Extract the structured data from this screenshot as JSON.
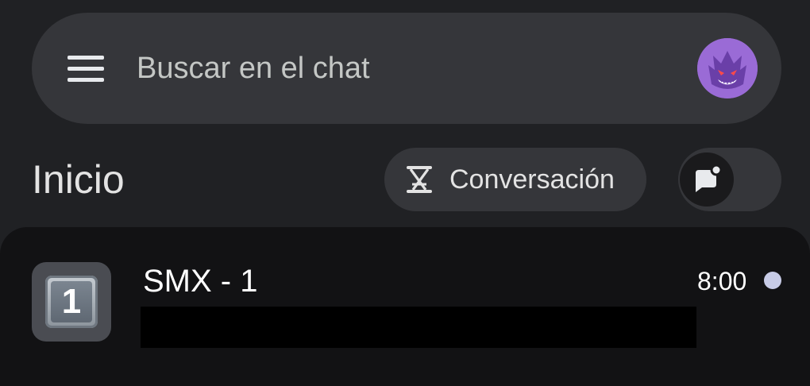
{
  "search": {
    "placeholder": "Buscar en el chat"
  },
  "header": {
    "title": "Inicio",
    "conversation_chip_label": "Conversación"
  },
  "chats": [
    {
      "name": "SMX - 1",
      "avatar_glyph": "1",
      "time": "8:00",
      "unread": true
    }
  ],
  "icons": {
    "menu": "hamburger-menu-icon",
    "avatar": "profile-avatar",
    "conversation": "conversation-summary-icon",
    "toggle": "chat-bubble-badge-icon",
    "unread": "unread-dot"
  },
  "colors": {
    "background": "#202124",
    "surface": "#35363a",
    "card": "#121214",
    "avatar_purple": "#9a6bd6",
    "unread_dot": "#c7cbe6"
  }
}
